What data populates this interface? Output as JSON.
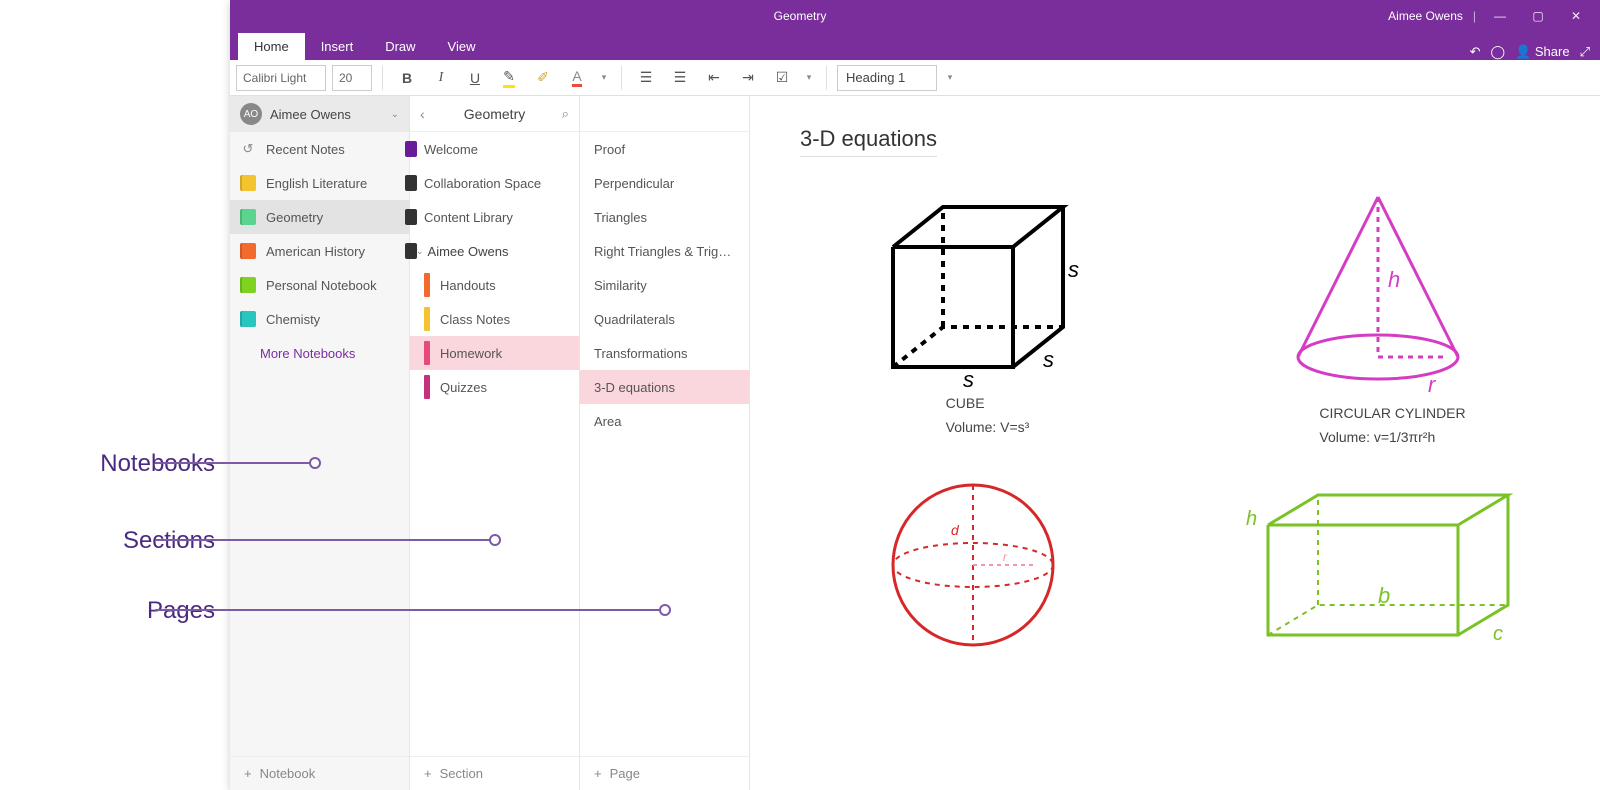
{
  "window": {
    "title": "Geometry",
    "user": "Aimee Owens"
  },
  "ribbon": {
    "tabs": [
      "Home",
      "Insert",
      "Draw",
      "View"
    ],
    "active_tab": "Home",
    "share_label": "Share"
  },
  "toolbar": {
    "font": "Calibri Light",
    "font_size": "20",
    "style": "Heading 1"
  },
  "notebooks": {
    "account_label": "Aimee Owens",
    "account_initials": "AO",
    "items": [
      {
        "label": "Recent Notes",
        "icon": "clock",
        "marker": "#6a1b9a"
      },
      {
        "label": "English Literature",
        "icon": "book",
        "color": "#f4c430",
        "marker": "#333"
      },
      {
        "label": "Geometry",
        "icon": "book",
        "color": "#5bd48f",
        "selected": true,
        "marker": "#333"
      },
      {
        "label": "American History",
        "icon": "book",
        "color": "#f26a2e",
        "marker": "#333"
      },
      {
        "label": "Personal Notebook",
        "icon": "book",
        "color": "#7ed321"
      },
      {
        "label": "Chemisty",
        "icon": "book",
        "color": "#29c5c1"
      }
    ],
    "more_label": "More Notebooks",
    "add_label": "Notebook"
  },
  "sections": {
    "header": "Geometry",
    "items": [
      {
        "label": "Welcome"
      },
      {
        "label": "Collaboration Space"
      },
      {
        "label": "Content Library"
      }
    ],
    "group_label": "Aimee Owens",
    "group_items": [
      {
        "label": "Handouts",
        "color": "#f26a2e"
      },
      {
        "label": "Class Notes",
        "color": "#f4c430"
      },
      {
        "label": "Homework",
        "color": "#e6497a",
        "selected": true
      },
      {
        "label": "Quizzes",
        "color": "#c42f7e"
      }
    ],
    "add_label": "Section"
  },
  "pages": {
    "items": [
      {
        "label": "Proof"
      },
      {
        "label": "Perpendicular"
      },
      {
        "label": "Triangles"
      },
      {
        "label": "Right Triangles & Trig…"
      },
      {
        "label": "Similarity"
      },
      {
        "label": "Quadrilaterals"
      },
      {
        "label": "Transformations"
      },
      {
        "label": "3-D equations",
        "selected": true
      },
      {
        "label": "Area"
      }
    ],
    "add_label": "Page"
  },
  "sheet": {
    "title": "3-D equations",
    "shape1_name": "CUBE",
    "shape1_vol": "Volume: V=s³",
    "shape2_name": "CIRCULAR CYLINDER",
    "shape2_vol": "Volume: v=1/3πr²h"
  },
  "annotations": {
    "a1": "Notebooks",
    "a2": "Sections",
    "a3": "Pages"
  }
}
